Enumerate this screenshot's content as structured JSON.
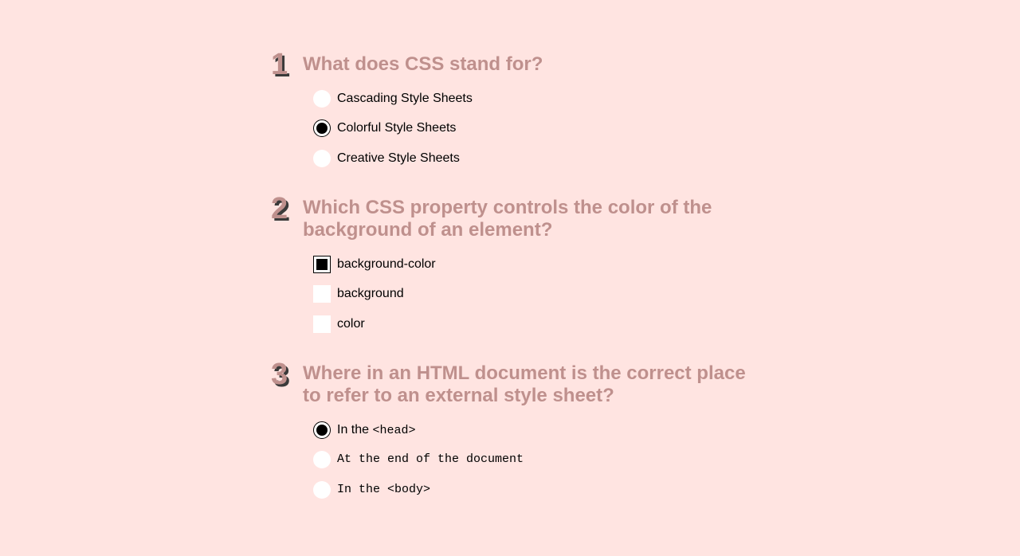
{
  "questions": [
    {
      "number": "1",
      "text": "What does CSS stand for?",
      "input_type": "radio",
      "options": [
        {
          "label": "Cascading Style Sheets",
          "checked": false
        },
        {
          "label": "Colorful Style Sheets",
          "checked": true
        },
        {
          "label": "Creative Style Sheets",
          "checked": false
        }
      ]
    },
    {
      "number": "2",
      "text": "Which CSS property controls the color of the background of an element?",
      "input_type": "checkbox",
      "options": [
        {
          "label": "background-color",
          "checked": true
        },
        {
          "label": "background",
          "checked": false
        },
        {
          "label": "color",
          "checked": false
        }
      ]
    },
    {
      "number": "3",
      "text": "Where in an HTML document is the correct place to refer to an external style sheet?",
      "input_type": "radio",
      "options": [
        {
          "label_prefix": "In the ",
          "label_code": "<head>",
          "checked": true
        },
        {
          "label": "At the end of the document",
          "checked": false
        },
        {
          "label": "In the <body>",
          "checked": false
        }
      ]
    }
  ],
  "colors": {
    "background": "#ffe4e1",
    "question_text": "#bf908d",
    "number_shadow": "#3a3a3a"
  }
}
